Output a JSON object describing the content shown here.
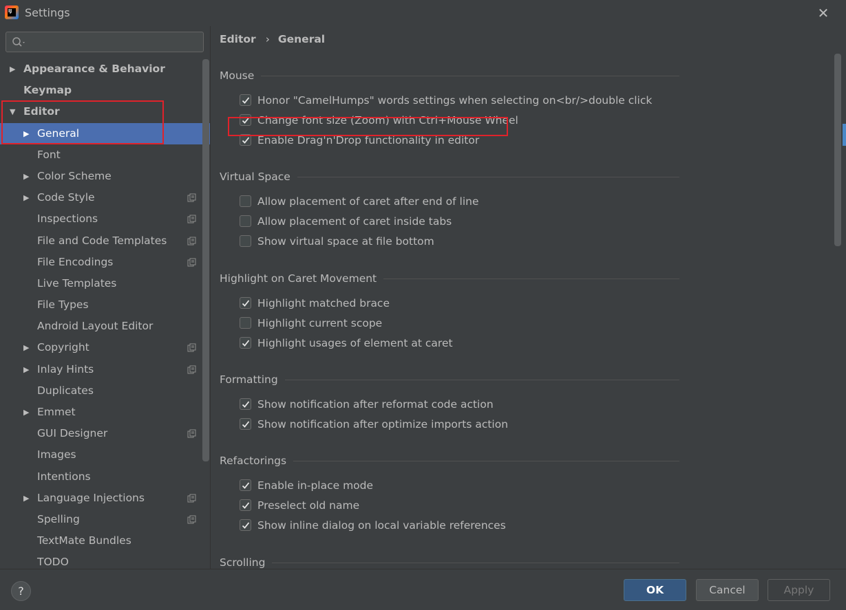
{
  "window": {
    "title": "Settings",
    "logo_text": "IJ"
  },
  "search": {
    "placeholder": "",
    "value": ""
  },
  "tree": [
    {
      "label": "Appearance & Behavior",
      "level": 0,
      "bold": true,
      "arrow": "right"
    },
    {
      "label": "Keymap",
      "level": 0,
      "bold": true,
      "arrow": ""
    },
    {
      "label": "Editor",
      "level": 0,
      "bold": true,
      "arrow": "down"
    },
    {
      "label": "General",
      "level": 1,
      "selected": true,
      "arrow": "right"
    },
    {
      "label": "Font",
      "level": 1,
      "arrow": ""
    },
    {
      "label": "Color Scheme",
      "level": 1,
      "arrow": "right"
    },
    {
      "label": "Code Style",
      "level": 1,
      "arrow": "right",
      "project_icon": true
    },
    {
      "label": "Inspections",
      "level": 1,
      "arrow": "",
      "project_icon": true
    },
    {
      "label": "File and Code Templates",
      "level": 1,
      "arrow": "",
      "project_icon": true
    },
    {
      "label": "File Encodings",
      "level": 1,
      "arrow": "",
      "project_icon": true
    },
    {
      "label": "Live Templates",
      "level": 1,
      "arrow": ""
    },
    {
      "label": "File Types",
      "level": 1,
      "arrow": ""
    },
    {
      "label": "Android Layout Editor",
      "level": 1,
      "arrow": ""
    },
    {
      "label": "Copyright",
      "level": 1,
      "arrow": "right",
      "project_icon": true
    },
    {
      "label": "Inlay Hints",
      "level": 1,
      "arrow": "right",
      "project_icon": true
    },
    {
      "label": "Duplicates",
      "level": 1,
      "arrow": ""
    },
    {
      "label": "Emmet",
      "level": 1,
      "arrow": "right"
    },
    {
      "label": "GUI Designer",
      "level": 1,
      "arrow": "",
      "project_icon": true
    },
    {
      "label": "Images",
      "level": 1,
      "arrow": ""
    },
    {
      "label": "Intentions",
      "level": 1,
      "arrow": ""
    },
    {
      "label": "Language Injections",
      "level": 1,
      "arrow": "right",
      "project_icon": true
    },
    {
      "label": "Spelling",
      "level": 1,
      "arrow": "",
      "project_icon": true
    },
    {
      "label": "TextMate Bundles",
      "level": 1,
      "arrow": ""
    },
    {
      "label": "TODO",
      "level": 1,
      "arrow": ""
    }
  ],
  "breadcrumb": {
    "parent": "Editor",
    "separator": "›",
    "current": "General"
  },
  "sections": [
    {
      "title": "Mouse",
      "options": [
        {
          "label": "Honor \"CamelHumps\" words settings when selecting on<br/>double click",
          "checked": true
        },
        {
          "label": "Change font size (Zoom) with Ctrl+Mouse Wheel",
          "checked": true
        },
        {
          "label": "Enable Drag'n'Drop functionality in editor",
          "checked": true
        }
      ]
    },
    {
      "title": "Virtual Space",
      "options": [
        {
          "label": "Allow placement of caret after end of line",
          "checked": false
        },
        {
          "label": "Allow placement of caret inside tabs",
          "checked": false
        },
        {
          "label": "Show virtual space at file bottom",
          "checked": false
        }
      ]
    },
    {
      "title": "Highlight on Caret Movement",
      "options": [
        {
          "label": "Highlight matched brace",
          "checked": true
        },
        {
          "label": "Highlight current scope",
          "checked": false
        },
        {
          "label": "Highlight usages of element at caret",
          "checked": true
        }
      ]
    },
    {
      "title": "Formatting",
      "options": [
        {
          "label": "Show notification after reformat code action",
          "checked": true
        },
        {
          "label": "Show notification after optimize imports action",
          "checked": true
        }
      ]
    },
    {
      "title": "Refactorings",
      "options": [
        {
          "label": "Enable in-place mode",
          "checked": true
        },
        {
          "label": "Preselect old name",
          "checked": true
        },
        {
          "label": "Show inline dialog on local variable references",
          "checked": true
        }
      ]
    },
    {
      "title": "Scrolling",
      "options": []
    }
  ],
  "buttons": {
    "help": "?",
    "ok": "OK",
    "cancel": "Cancel",
    "apply": "Apply"
  },
  "colors": {
    "background": "#3c3f41",
    "selection": "#4b6eaf",
    "ok_button": "#365880",
    "highlight_box": "#e0222a"
  }
}
